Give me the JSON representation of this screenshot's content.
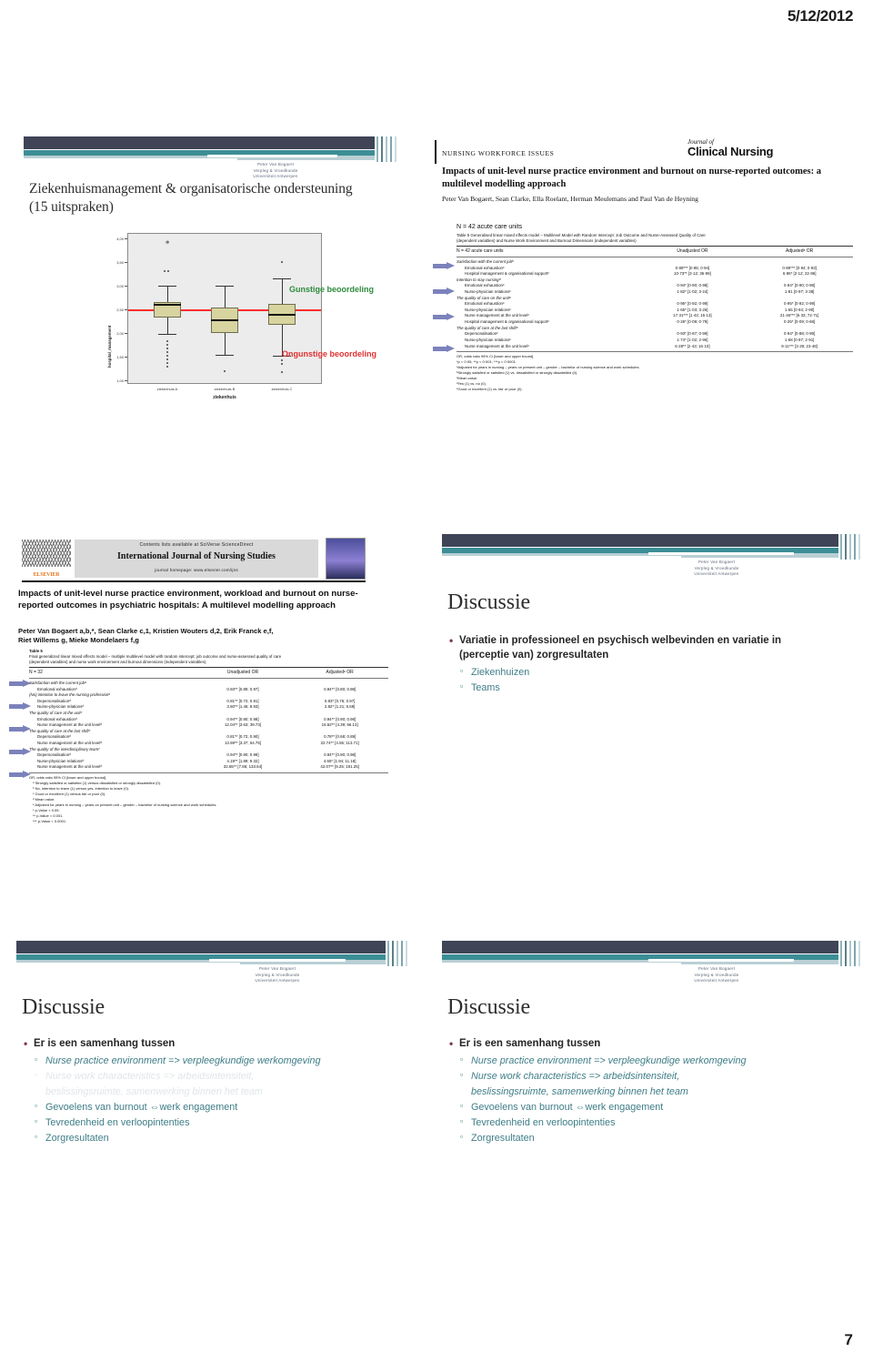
{
  "page": {
    "date": "5/12/2012",
    "page_number": "7"
  },
  "watermark": {
    "line1": "Peter Van Bogaert",
    "line2": "Verpleg & Vroedkunde",
    "line3": "Universiteit Antwerpen"
  },
  "slides": [
    {
      "id": "slide-boxplot",
      "title": "Ziekenhuismanagement & organisatorische ondersteuning (15 uitspraken)",
      "annotations": {
        "favorable": "Gunstige beoordeling",
        "unfavorable": "Ongunstige beoordeling"
      }
    },
    {
      "id": "slide-jcn-table",
      "journal": {
        "kicker": "NURSING WORKFORCE ISSUES",
        "brand_small": "Journal of",
        "brand": "Clinical Nursing",
        "title": "Impacts of unit-level nurse practice environment and burnout on nurse-reported outcomes: a multilevel modelling approach",
        "authors": "Peter Van Bogaert, Sean Clarke, Ella Roelant, Herman Meulemans and Paul Van de Heyning"
      },
      "n_units": "N = 42 acute care units"
    },
    {
      "id": "slide-ijns-table",
      "journal": {
        "contents": "Contents lists available at SciVerse ScienceDirect",
        "name": "International Journal of Nursing Studies",
        "homepage": "journal homepage: www.elsevier.com/ijns",
        "publisher": "ELSEVIER",
        "title": "Impacts of unit-level nurse practice environment, workload and burnout on nurse-reported outcomes in psychiatric hospitals: A multilevel modelling approach",
        "authors_line1": "Peter Van Bogaert a,b,*, Sean Clarke c,1, Kristien Wouters d,2, Erik Franck e,f,",
        "authors_line2": "Riet Willems g, Mieke Mondelaers f,g"
      }
    },
    {
      "id": "slide-discussie-1",
      "title": "Discussie",
      "bullets": [
        {
          "level": 1,
          "text": "Variatie in professioneel en psychisch welbevinden en variatie in (perceptie van) zorgresultaten"
        },
        {
          "level": 2,
          "text": "Ziekenhuizen"
        },
        {
          "level": 2,
          "text": "Teams"
        }
      ]
    },
    {
      "id": "slide-discussie-2",
      "title": "Discussie",
      "bullets": [
        {
          "level": 1,
          "text": "Er is een samenhang tussen"
        },
        {
          "level": 2,
          "text": "Nurse practice environment => verpleegkundige werkomgeving",
          "italic": true
        },
        {
          "level": 2,
          "text": "Nurse work characteristics => arbeidsintensiteit,",
          "italic": true,
          "faded": true
        },
        {
          "level": 2,
          "text": "beslissingsruimte, samenwerking binnen het team",
          "italic": true,
          "faded": true,
          "continuation": true
        },
        {
          "level": 2,
          "text": "Gevoelens van burnout ⇔werk engagement"
        },
        {
          "level": 2,
          "text": "Tevredenheid en verloopintenties"
        },
        {
          "level": 2,
          "text": "Zorgresultaten"
        }
      ]
    },
    {
      "id": "slide-discussie-3",
      "title": "Discussie",
      "bullets": [
        {
          "level": 1,
          "text": "Er is een samenhang tussen"
        },
        {
          "level": 2,
          "text": "Nurse practice environment => verpleegkundige werkomgeving",
          "italic": true
        },
        {
          "level": 2,
          "text": "Nurse work characteristics => arbeidsintensiteit,",
          "italic": true
        },
        {
          "level": 2,
          "text": "beslissingsruimte, samenwerking binnen het team",
          "italic": true,
          "continuation": true
        },
        {
          "level": 2,
          "text": "Gevoelens van burnout ⇔werk engagement"
        },
        {
          "level": 2,
          "text": "Tevredenheid en verloopintenties"
        },
        {
          "level": 2,
          "text": "Zorgresultaten"
        }
      ]
    }
  ],
  "chart_data": {
    "type": "boxplot",
    "title": "",
    "xlabel": "ziekenhuis",
    "ylabel": "hospital_management",
    "ylim": [
      1.0,
      4.0
    ],
    "yticks": [
      "1,00",
      "1,50",
      "2,00",
      "2,50",
      "3,00",
      "3,50",
      "4,00"
    ],
    "categories": [
      "ziekenhuis A",
      "ziekenhuis B",
      "ziekenhuis C"
    ],
    "reference_line": 2.5,
    "reference_line_color": "#ff2d2d",
    "grid": false,
    "legend_position": "right-annotations",
    "boxes": [
      {
        "category": "ziekenhuis A",
        "whisker_low": 1.95,
        "q1": 2.4,
        "median": 2.61,
        "q3": 2.73,
        "whisker_high": 3.2,
        "outliers": [
          3.31,
          3.33,
          1.86,
          1.82,
          1.78,
          1.74,
          1.7,
          1.66,
          1.62,
          1.58,
          1.54,
          1.5
        ],
        "extreme": [
          3.93
        ]
      },
      {
        "category": "ziekenhuis B",
        "whisker_low": 1.54,
        "q1": 2.0,
        "median": 2.26,
        "q3": 2.54,
        "whisker_high": 3.2,
        "outliers": [
          1.18
        ],
        "extreme": []
      },
      {
        "category": "ziekenhuis C",
        "whisker_low": 1.52,
        "q1": 2.22,
        "median": 2.41,
        "q3": 2.66,
        "whisker_high": 3.35,
        "outliers": [
          3.52,
          1.47,
          1.44,
          1.18
        ],
        "extreme": []
      }
    ]
  },
  "table_jcn": {
    "caption_line1": "Table 5 Generalised linear mixed effects model – Multilevel Model with Random Intercept: Job Outcome and Nurse-Assessed Quality of Care",
    "caption_line2": "(dependent variables) and Nurse Work Environment and Burnout Dimensions (independent variables)",
    "columns": [
      "N = 42 acute care units",
      "Unadjusted OR",
      "Adjustedᵃ OR"
    ],
    "rows": [
      {
        "type": "group",
        "label": "Satisfaction with the current jobᵇ"
      },
      {
        "type": "item",
        "arrow": true,
        "label": "Emotional exhaustionᶜ",
        "unadjusted": "0·89*** [0·85; 0·94]",
        "adjusted": "0·89*** [0·84; 0·93]"
      },
      {
        "type": "item",
        "label": "Hospital management & organisational supportᶜ",
        "unadjusted": "10·73** [3·12; 36·99]",
        "adjusted": "6·96* [2·12; 22·86]"
      },
      {
        "type": "group",
        "label": "Intention to stay nursingᵈ"
      },
      {
        "type": "item",
        "arrow": true,
        "label": "Emotional exhaustionᶜ",
        "unadjusted": "0·94* [0·90; 0·98]",
        "adjusted": "0·94* [0·90; 0·98]"
      },
      {
        "type": "item",
        "label": "Nurse-physician relationsᶜ",
        "unadjusted": "1·82* [1·02; 3·24]",
        "adjusted": "1·81 [0·97; 3·38]"
      },
      {
        "type": "group",
        "label": "The quality of care on the unitᵉ"
      },
      {
        "type": "item",
        "arrow": true,
        "label": "Emotional exhaustionᶜ",
        "unadjusted": "0·95* [0·92; 0·99]",
        "adjusted": "0·95* [0·92; 0·99]"
      },
      {
        "type": "item",
        "label": "Nurse-physician relationsᶜ",
        "unadjusted": "1·65* [1·03; 3·26]",
        "adjusted": "1·65 [0·94; 2·90]"
      },
      {
        "type": "item",
        "label": "Nurse management at the unit levelᶜ",
        "unadjusted": "17·31*** [1·43; 15·13]",
        "adjusted": "21·46*** [6·33; 72·71]"
      },
      {
        "type": "item",
        "label": "Hospital management & organisational supportᶜ",
        "unadjusted": "0·26* [0·09; 0·79]",
        "adjusted": "0·25* [0·09; 0·68]"
      },
      {
        "type": "group",
        "label": "The quality of care at the last shiftᵉ"
      },
      {
        "type": "item",
        "arrow": true,
        "label": "Depersonalisationᶜ",
        "unadjusted": "0·93* [0·87; 0·99]",
        "adjusted": "0·94* [0·88; 0·99]"
      },
      {
        "type": "item",
        "label": "Nurse-physician relationsᶜ",
        "unadjusted": "1·74* [1·02; 2·96]",
        "adjusted": "1·68 [0·97; 2·91]"
      },
      {
        "type": "item",
        "label": "Nurse management at the unit levelᶜ",
        "unadjusted": "6·28** [2·43; 16·10]",
        "adjusted": "9·11*** [3·29; 23·48]"
      }
    ],
    "notes": [
      "OR, odds ratio 95% CI [lower and upper bound].",
      "*p < 0·05; **p < 0·001; ***p < 0·0001.",
      "ᵃAdjusted for years in nursing – years on present unit – gender – bachelor of nursing science and work schedules.",
      "ᵇStrongly satisfied or satisfied (1) vs. dissatisfied or strongly dissatisfied (0).",
      "ᶜMean value.",
      "ᵈYes (1) vs. no (0).",
      "ᵉGood or excellent (1) vs. fair or poor (0)."
    ]
  },
  "table_ijns": {
    "number": "Table 5",
    "caption_line1": "Final generalized linear mixed effects model – multiple multilevel model with random intercept: job outcome and nurse-assessed quality of care",
    "caption_line2": "(dependent variables) and nurse work environment and burnout dimensions (independent variables).",
    "columns": [
      "N = 32",
      "Unadjusted OR",
      "Adjustedᵉ OR"
    ],
    "rows": [
      {
        "type": "group",
        "label": "Satisfaction with the current jobᵃ"
      },
      {
        "type": "item",
        "arrow": true,
        "label": "Emotional exhaustionᵈ",
        "unadjusted": "0.93** [0.89; 0.97]",
        "adjusted": "0.94** [0.80; 0.98]"
      },
      {
        "type": "group",
        "label": "(No) intention to leave the nursing professionᵇ"
      },
      {
        "type": "item",
        "arrow": true,
        "label": "Depersonalisationᵈ",
        "unadjusted": "0.81** [0.72; 0.91]",
        "adjusted": "0.83* [0.76; 0.97]"
      },
      {
        "type": "item",
        "label": "Nurse-physician relationsᵈ",
        "unadjusted": "3.60** [1.46; 8.93]",
        "adjusted": "2.82* [1.21; 6.59]"
      },
      {
        "type": "group",
        "label": "The quality of care at the unitᶜ"
      },
      {
        "type": "item",
        "arrow": true,
        "label": "Emotional exhaustionᵈ",
        "unadjusted": "0.94** [0.90; 0.98]",
        "adjusted": "0.94** [0.90; 0.98]"
      },
      {
        "type": "item",
        "label": "Nurse management at the unit levelᵈ",
        "unadjusted": "12.04** [3.63; 39.73]",
        "adjusted": "16.62** [4.39; 66.13]"
      },
      {
        "type": "group",
        "label": "The quality of care at the last shiftᶜ"
      },
      {
        "type": "item",
        "arrow": true,
        "label": "Depersonalisationᵈ",
        "unadjusted": "0.81** [0.72; 0.90]",
        "adjusted": "0.78** [0.68; 0.89]"
      },
      {
        "type": "item",
        "label": "Nurse management at the unit levelᵈ",
        "unadjusted": "13.59** [3.37; 54.75]",
        "adjusted": "22.74** [4.55; 113.71]"
      },
      {
        "type": "group",
        "label": "The quality of the interdisciplinary teamᶜ"
      },
      {
        "type": "item",
        "arrow": true,
        "label": "Depersonalisationᵈ",
        "unadjusted": "0.94** [0.90; 0.98]",
        "adjusted": "0.94** [0.90; 0.98]"
      },
      {
        "type": "item",
        "label": "Nurse-physician relationsᵈ",
        "unadjusted": "4.19** [1.89; 9.32]",
        "adjusted": "4.65* [1.94; 11.18]"
      },
      {
        "type": "item",
        "label": "Nurse management at the unit levelᵈ",
        "unadjusted": "32.65** [7.86; 133.64]",
        "adjusted": "42.07** [9.25; 191.25]"
      }
    ],
    "notes": [
      "OR, odds ratio 95% CI [lower and upper bound].",
      "ᵃ Strongly satisfied or satisfied (1) versus dissatisfied or strongly dissatisfied (0).",
      "ᵇ No, intention to leave (1) versus yes, intention to leave (0).",
      "ᶜ Good or excellent (1) versus fair or poor (0).",
      "ᵈ Mean value.",
      "ᵉ Adjusted for years in nursing – years on present unit – gender – bachelor of nursing science and work schedules.",
      "* p-Value < 0.05.",
      "** p-Value < 0.001.",
      "*** p-Value < 0.0001."
    ]
  },
  "colors": {
    "header_dark": "#3f4457",
    "header_teal": "#3c8e95",
    "bullet_teal": "#3e7d87",
    "bullet_dot": "#7a3b52",
    "favorable": "#2e8b3d",
    "unfavorable": "#e03232",
    "arrow": "#7b82bb",
    "box_fill": "#d7d4a0"
  }
}
